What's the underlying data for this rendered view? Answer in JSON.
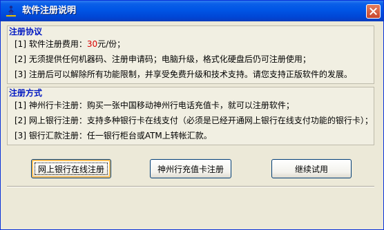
{
  "window": {
    "title": "软件注册说明"
  },
  "agreement": {
    "heading": "注册协议",
    "items": [
      {
        "prefix": "[1] 软件注册费用：",
        "price": "30",
        "suffix": "元/份；"
      },
      {
        "text": "[2] 无须提供任何机器码、注册申请码；电脑升级，格式化硬盘后仍可注册使用；"
      },
      {
        "text": "[3] 注册后可以解除所有功能限制，并享受免费升级和技术支持。请您支持正版软件的发展。"
      }
    ]
  },
  "methods": {
    "heading": "注册方式",
    "items": [
      {
        "text": "[1] 神州行卡注册：购买一张中国移动神州行电话充值卡，就可以注册软件；"
      },
      {
        "text": "[2] 网上银行注册：支持多种银行卡在线支付（必须是已经开通网上银行在线支付功能的银行卡）；"
      },
      {
        "text": "[3] 银行汇款注册：任一银行柜台或ATM上转帐汇款。"
      }
    ]
  },
  "buttons": {
    "online_bank": "网上银行在线注册",
    "szx_card": "神州行充值卡注册",
    "continue_trial": "继续试用"
  },
  "colors": {
    "title_bar": "#0054E3",
    "heading": "#0018C2",
    "price": "#D80000",
    "close_button": "#C8452D"
  },
  "icons": {
    "app": "app-figure-icon",
    "close": "close-icon"
  }
}
